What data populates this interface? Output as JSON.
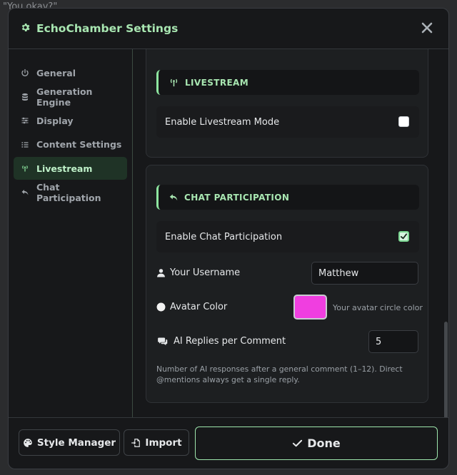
{
  "background_text": {
    "line1": "\"You okay?\""
  },
  "modal": {
    "title": "EchoChamber Settings",
    "close_label": "×"
  },
  "sidebar": {
    "items": [
      {
        "label": "General",
        "icon": "power-icon"
      },
      {
        "label": "Generation Engine",
        "icon": "database-icon"
      },
      {
        "label": "Display",
        "icon": "sliders-icon"
      },
      {
        "label": "Content Settings",
        "icon": "list-icon"
      },
      {
        "label": "Livestream",
        "icon": "broadcast-icon",
        "active": true
      },
      {
        "label": "Chat Participation",
        "icon": "reply-icon"
      }
    ]
  },
  "livestream": {
    "header": "LIVESTREAM",
    "enable_label": "Enable Livestream Mode",
    "enabled": false
  },
  "chat_participation": {
    "header": "CHAT PARTICIPATION",
    "enable_label": "Enable Chat Participation",
    "enabled": true,
    "username_label": "Your Username",
    "username_value": "Matthew",
    "avatar_label": "Avatar Color",
    "avatar_color": "#f03ee0",
    "avatar_hint": "Your avatar circle color",
    "replies_label": "AI Replies per Comment",
    "replies_value": "5",
    "help_text": "Number of AI responses after a general comment (1–12). Direct @mentions always get a single reply."
  },
  "footer": {
    "style_manager_label": "Style Manager",
    "import_label": "Import",
    "done_label": "Done"
  },
  "colors": {
    "accent": "#a8e6b1",
    "active_nav_bg": "#1f3326",
    "panel_bg": "#17181a"
  }
}
